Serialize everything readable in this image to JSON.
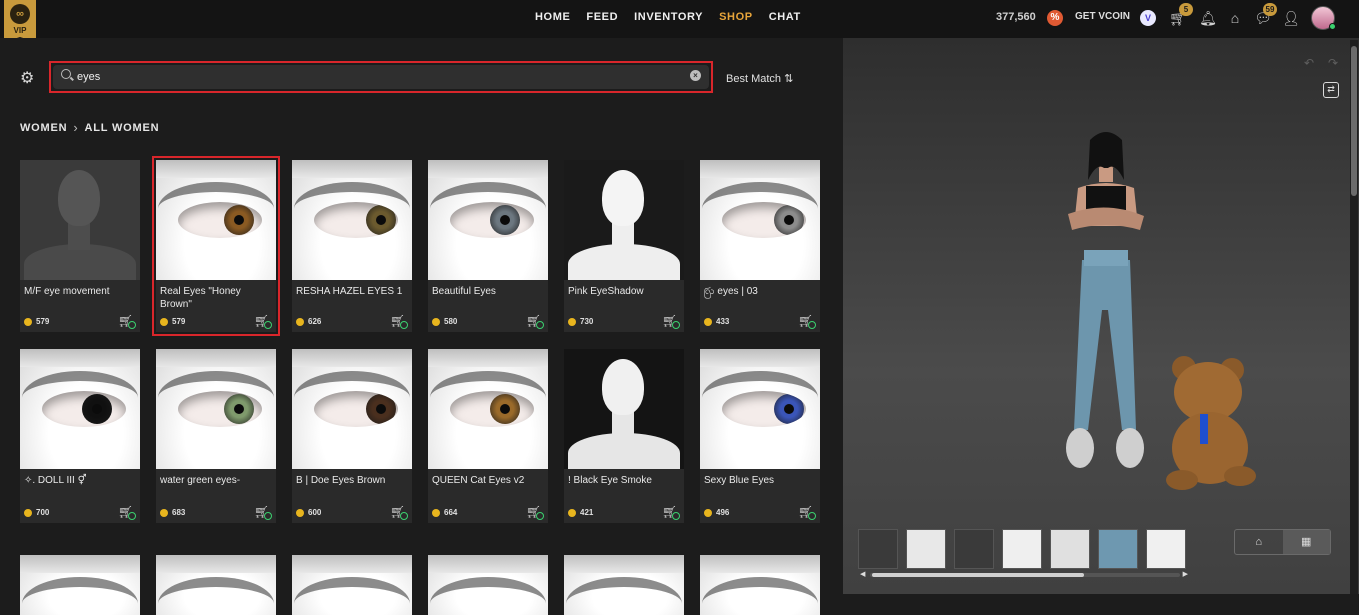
{
  "topbar": {
    "vip_label": "VIP",
    "nav": [
      "HOME",
      "FEED",
      "INVENTORY",
      "SHOP",
      "CHAT"
    ],
    "active_nav": "SHOP",
    "credits": "377,560",
    "get_vcoin": "GET VCOIN",
    "cart_count": "5",
    "messages_count": "59"
  },
  "search": {
    "value": "eyes",
    "placeholder": "Search",
    "sort_label": "Best Match ⇅"
  },
  "breadcrumb": [
    "WOMEN",
    "ALL WOMEN"
  ],
  "products": [
    {
      "name": "M/F eye movement",
      "price": "579",
      "kind": "head",
      "iris": "#555"
    },
    {
      "name": "Real Eyes \"Honey Brown\"",
      "price": "579",
      "kind": "eye",
      "iris": "#8a5a22",
      "selected": true
    },
    {
      "name": "RESHA HAZEL EYES 1",
      "price": "626",
      "kind": "eye",
      "iris": "#6b5a2e"
    },
    {
      "name": "Beautiful Eyes",
      "price": "580",
      "kind": "eye",
      "iris": "#6c7780"
    },
    {
      "name": "Pink EyeShadow",
      "price": "730",
      "kind": "whitehead",
      "iris": "#d98"
    },
    {
      "name": "ꩺ eyes | 03",
      "price": "433",
      "kind": "eye",
      "iris": "#8c8c8c"
    },
    {
      "name": "✧. DOLL III ⚥",
      "price": "700",
      "kind": "eye",
      "iris": "#101010"
    },
    {
      "name": "water green eyes-",
      "price": "683",
      "kind": "eye",
      "iris": "#7f9a6c"
    },
    {
      "name": "B | Doe Eyes Brown",
      "price": "600",
      "kind": "eye",
      "iris": "#4a2f1e"
    },
    {
      "name": "QUEEN Cat Eyes v2",
      "price": "664",
      "kind": "eye",
      "iris": "#9a6a2a"
    },
    {
      "name": "! Black Eye Smoke",
      "price": "421",
      "kind": "smokehead",
      "iris": "#000"
    },
    {
      "name": "Sexy Blue Eyes",
      "price": "496",
      "kind": "eye",
      "iris": "#3a55b8"
    }
  ]
}
